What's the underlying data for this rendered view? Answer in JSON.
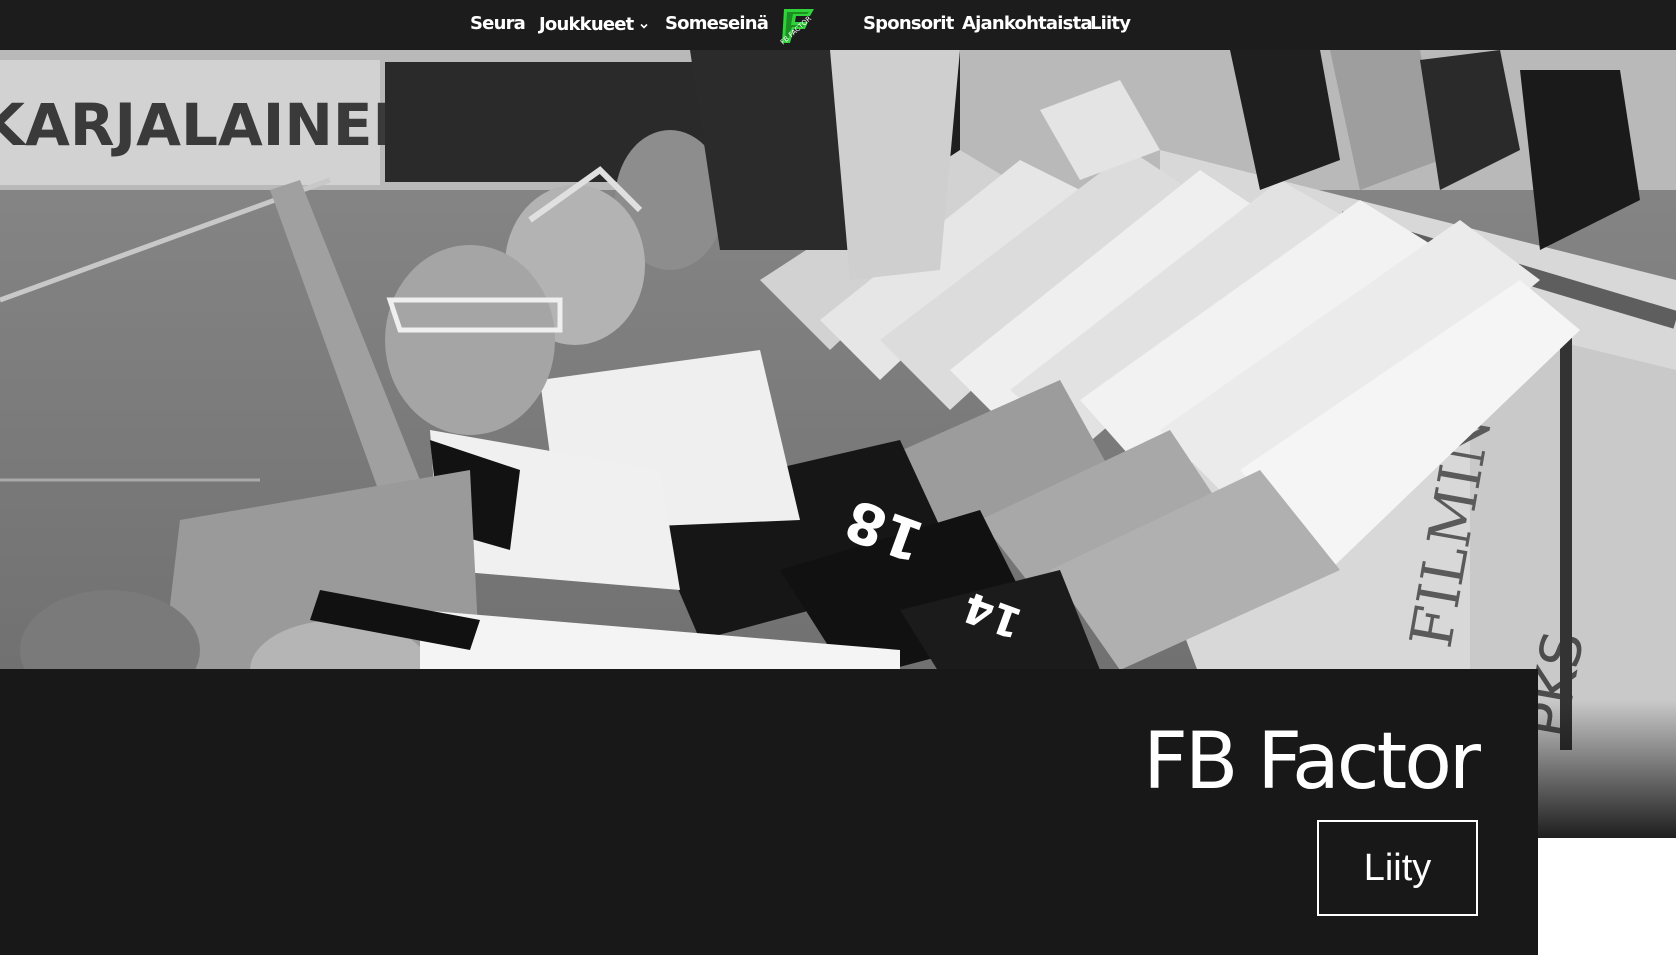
{
  "nav": {
    "left_items": [
      {
        "label": "Seura"
      },
      {
        "label": "Joukkueet",
        "has_dropdown": true
      },
      {
        "label": "Someseinä"
      }
    ],
    "right_items": [
      {
        "label": "Sponsorit"
      },
      {
        "label": "Ajankohtaista"
      },
      {
        "label": "Liity"
      }
    ],
    "logo": {
      "icon": "fb-factor-logo-icon",
      "text": "FB FACTOR",
      "accent_color": "#2fd33a"
    }
  },
  "hero": {
    "image": "grayscale photo of young floorball players lying on their backs with legs raised on the rink boards",
    "visible_text": {
      "banner": "KARJALAINEN",
      "jersey_a": "18",
      "jersey_b": "14",
      "board_a": "FILMINO",
      "board_b": "PKS"
    }
  },
  "panel": {
    "title": "FB Factor",
    "cta_label": "Liity"
  },
  "colors": {
    "nav_bg": "#1c1c1c",
    "panel_bg": "#181818",
    "text": "#ffffff",
    "logo_green": "#2fd33a"
  }
}
